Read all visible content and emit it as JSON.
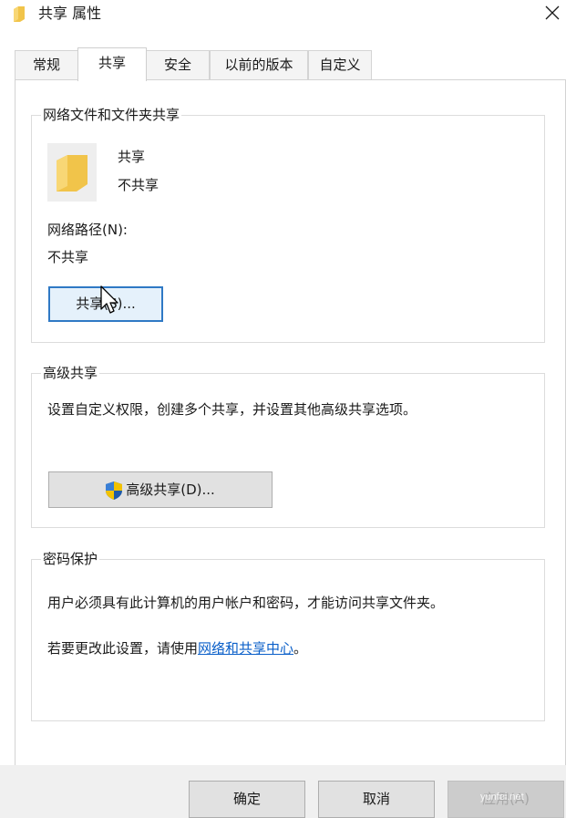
{
  "window": {
    "title": "共享 属性",
    "icon": "folder-icon",
    "close": "close-icon"
  },
  "tabs": [
    {
      "label": "常规",
      "active": false
    },
    {
      "label": "共享",
      "active": true
    },
    {
      "label": "安全",
      "active": false
    },
    {
      "label": "以前的版本",
      "active": false
    },
    {
      "label": "自定义",
      "active": false
    }
  ],
  "network_sharing": {
    "title": "网络文件和文件夹共享",
    "folder_name": "共享",
    "folder_status": "不共享",
    "path_label": "网络路径(N):",
    "path_value": "不共享",
    "share_button": "共享(S)..."
  },
  "advanced_sharing": {
    "title": "高级共享",
    "description": "设置自定义权限，创建多个共享，并设置其他高级共享选项。",
    "button": "高级共享(D)..."
  },
  "password_protection": {
    "title": "密码保护",
    "description": "用户必须具有此计算机的用户帐户和密码，才能访问共享文件夹。",
    "settings_prefix": "若要更改此设置，请使用",
    "settings_link": "网络和共享中心",
    "settings_suffix": "。"
  },
  "footer": {
    "ok": "确定",
    "cancel": "取消",
    "apply": "应用(A)"
  },
  "watermark": "yunfei.net",
  "colors": {
    "accent": "#2f79c5",
    "link": "#0a5fc9",
    "folder": "#f8d775"
  }
}
